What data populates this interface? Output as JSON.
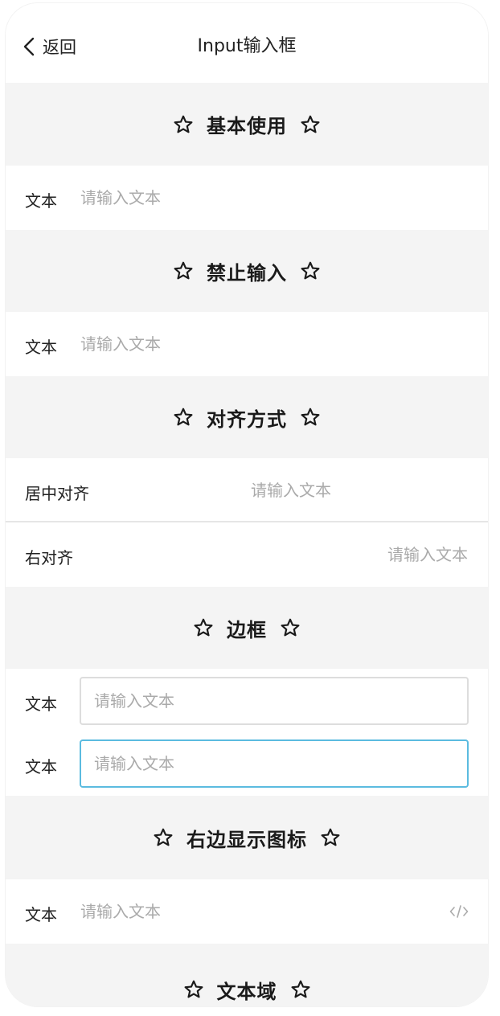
{
  "nav": {
    "back_label": "返回",
    "title": "Input输入框"
  },
  "sections": {
    "basic": {
      "title": "基本使用"
    },
    "disabled": {
      "title": "禁止输入"
    },
    "align": {
      "title": "对齐方式"
    },
    "border": {
      "title": "边框"
    },
    "icon": {
      "title": "右边显示图标"
    },
    "textarea": {
      "title": "文本域"
    }
  },
  "rows": {
    "basic": {
      "label": "文本",
      "placeholder": "请输入文本"
    },
    "disabled": {
      "label": "文本",
      "placeholder": "请输入文本"
    },
    "center": {
      "label": "居中对齐",
      "placeholder": "请输入文本"
    },
    "right": {
      "label": "右对齐",
      "placeholder": "请输入文本"
    },
    "border1": {
      "label": "文本",
      "placeholder": "请输入文本"
    },
    "border2": {
      "label": "文本",
      "placeholder": "请输入文本"
    },
    "icon": {
      "label": "文本",
      "placeholder": "请输入文本",
      "icon": "code-icon"
    }
  },
  "colors": {
    "section_bg": "#f4f4f4",
    "placeholder": "#aaaaaa",
    "focus_border": "#5bbbe0",
    "border": "#dddddd"
  }
}
